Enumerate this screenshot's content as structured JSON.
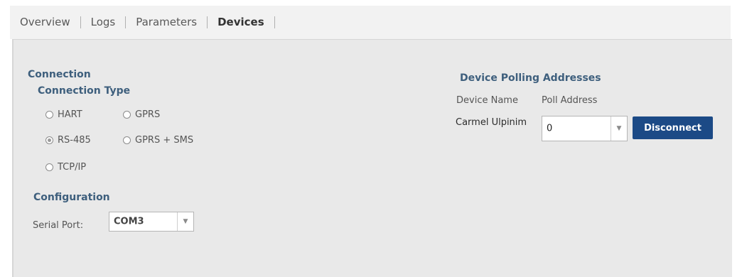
{
  "tabs": {
    "overview": "Overview",
    "logs": "Logs",
    "parameters": "Parameters",
    "devices": "Devices"
  },
  "connection": {
    "title": "Connection",
    "type_title": "Connection Type",
    "options": {
      "hart": "HART",
      "gprs": "GPRS",
      "rs485": "RS-485",
      "gprs_sms": "GPRS + SMS",
      "tcpip": "TCP/IP"
    },
    "selected": "RS-485"
  },
  "configuration": {
    "title": "Configuration",
    "serial_port_label": "Serial Port:",
    "serial_port_value": "COM3"
  },
  "polling": {
    "title": "Device Polling Addresses",
    "col_device_name": "Device Name",
    "col_poll_address": "Poll Address",
    "device_name": "Carmel Ulpinim",
    "poll_address": "0",
    "disconnect_label": "Disconnect"
  },
  "colors": {
    "accent_title": "#3e5f7d",
    "button_bg": "#1c4a86",
    "panel_bg": "#e9e9e9",
    "tabbar_bg": "#f2f2f2"
  },
  "icons": {
    "dropdown": "chevron-down-icon"
  }
}
